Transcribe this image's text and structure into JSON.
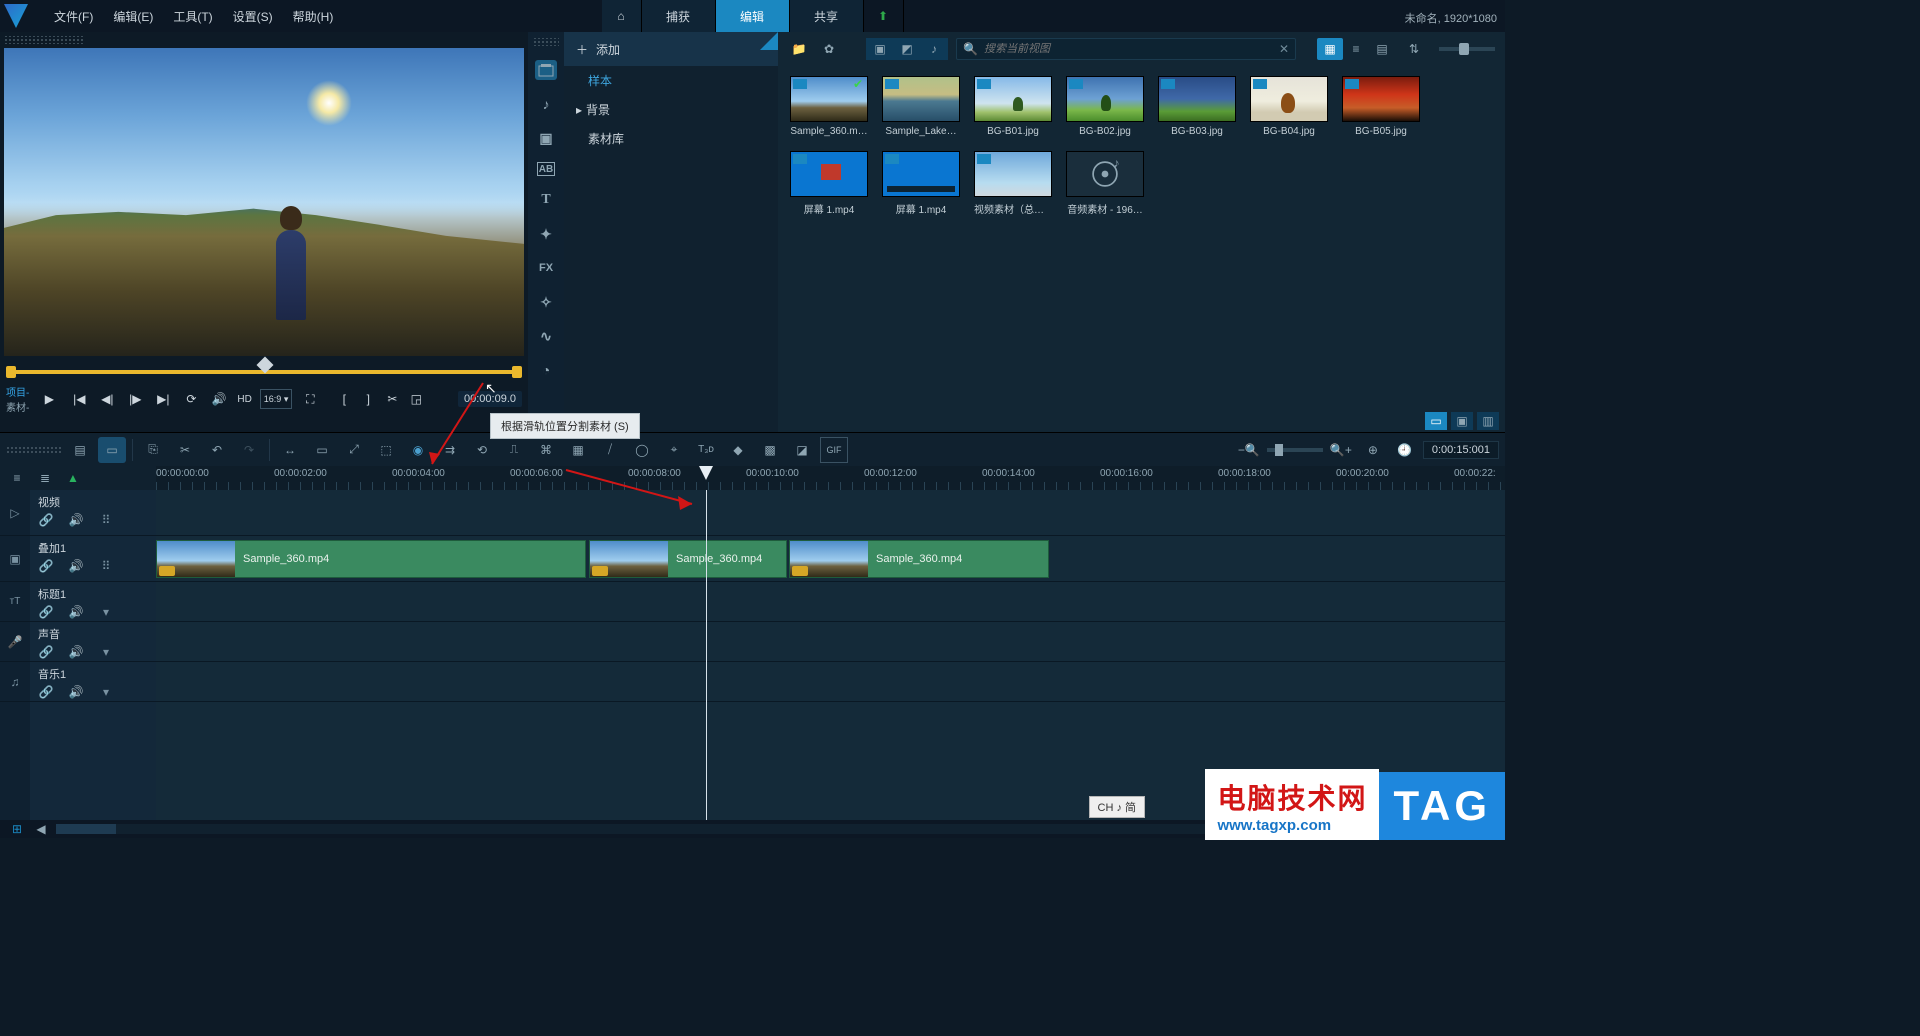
{
  "window": {
    "project_label": "未命名, 1920*1080"
  },
  "menu": {
    "file": "文件(F)",
    "edit": "编辑(E)",
    "tools": "工具(T)",
    "settings": "设置(S)",
    "help": "帮助(H)"
  },
  "top_tabs": {
    "home_icon": "⌂",
    "capture": "捕获",
    "edit": "编辑",
    "share": "共享",
    "upload_icon": "⬆"
  },
  "preview": {
    "mode_project": "项目-",
    "mode_clip": "素材-",
    "hd_label": "HD",
    "aspect_label": "16:9 ▾",
    "timecode": "00:00:09.0",
    "tooltip": "根据滑轨位置分割素材 (S)"
  },
  "side_nav": {
    "add": "添加",
    "tree_sample": "样本",
    "tree_background": "背景",
    "tree_library": "素材库"
  },
  "library": {
    "search_placeholder": "搜索当前视图",
    "items": [
      {
        "label": "Sample_360.m…",
        "thumb": "t-sample360",
        "checked": true
      },
      {
        "label": "Sample_Lake…",
        "thumb": "t-lake"
      },
      {
        "label": "BG-B01.jpg",
        "thumb": "t-b01"
      },
      {
        "label": "BG-B02.jpg",
        "thumb": "t-b02"
      },
      {
        "label": "BG-B03.jpg",
        "thumb": "t-b03"
      },
      {
        "label": "BG-B04.jpg",
        "thumb": "t-b04"
      },
      {
        "label": "BG-B05.jpg",
        "thumb": "t-b05"
      },
      {
        "label": "屏幕 1.mp4",
        "thumb": "t-desktop2"
      },
      {
        "label": "屏幕 1.mp4",
        "thumb": "t-desktop"
      },
      {
        "label": "视频素材（总）…",
        "thumb": "t-vid"
      },
      {
        "label": "音频素材 - 196…",
        "thumb": "t-audio"
      }
    ]
  },
  "timeline": {
    "total_duration": "0:00:15:001",
    "ruler_ticks": [
      "00:00:00:00",
      "00:00:02:00",
      "00:00:04:00",
      "00:00:06:00",
      "00:00:08:00",
      "00:00:10:00",
      "00:00:12:00",
      "00:00:14:00",
      "00:00:16:00",
      "00:00:18:00",
      "00:00:20:00",
      "00:00:22:"
    ],
    "tracks": [
      {
        "name": "视频",
        "type": "video"
      },
      {
        "name": "叠加1",
        "type": "overlay"
      },
      {
        "name": "标题1",
        "type": "title"
      },
      {
        "name": "声音",
        "type": "voice"
      },
      {
        "name": "音乐1",
        "type": "music"
      }
    ],
    "clip_label": "Sample_360.mp4"
  },
  "watermark": {
    "line1": "电脑技术网",
    "line2": "www.tagxp.com",
    "tag": "TAG"
  },
  "ime": "CH ♪ 简"
}
